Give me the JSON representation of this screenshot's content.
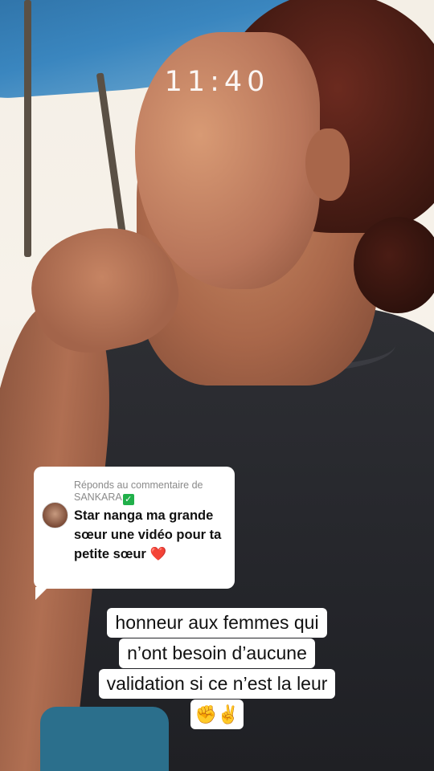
{
  "overlay": {
    "time": "11:40"
  },
  "reply_card": {
    "header": "Réponds au commentaire de SANKARA",
    "check_icon": "check-mark-icon",
    "comment": "Star nanga ma grande sœur une vidéo pour ta petite sœur",
    "heart": "❤️"
  },
  "caption": {
    "lines": [
      "honneur aux femmes qui",
      "n’ont besoin d’aucune",
      "validation si ce n’est la leur"
    ],
    "emoji": "✊✌️"
  },
  "colors": {
    "card_bg": "#ffffff",
    "check_green": "#21b04a",
    "heart_red": "#e0262d",
    "shirt": "#2e2f34"
  }
}
